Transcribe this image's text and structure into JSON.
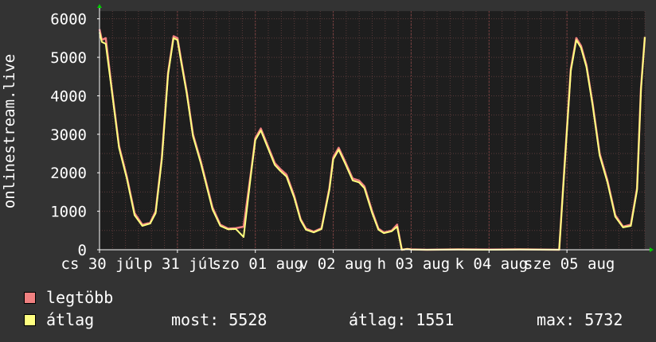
{
  "colors": {
    "background": "#333333",
    "plot_background": "#1e1e1e",
    "grid": "#5a3a3a",
    "axis": "#ffffff",
    "text": "#ffffff",
    "series_max": "#f08080",
    "series_avg": "#ffff80",
    "arrow": "#00cc00"
  },
  "ylabel": "onlinestream.live",
  "legend": {
    "max_label": "legtöbb",
    "avg_label": "átlag",
    "current_label": "most: 5528",
    "average_label": "átlag: 1551",
    "maximum_label": "max: 5732"
  },
  "chart_data": {
    "type": "line",
    "title": "",
    "xlabel": "",
    "ylabel": "onlinestream.live",
    "ylim": [
      0,
      6200
    ],
    "yticks": [
      0,
      1000,
      2000,
      3000,
      4000,
      5000,
      6000
    ],
    "xlim": [
      0,
      7.0
    ],
    "grid": true,
    "xticks": [
      {
        "pos": 0.0,
        "label": "cs 30 júl"
      },
      {
        "pos": 1.0,
        "label": "p 31 júl"
      },
      {
        "pos": 2.0,
        "label": "szo 01 aug"
      },
      {
        "pos": 3.0,
        "label": "v 02 aug"
      },
      {
        "pos": 4.0,
        "label": "h 03 aug"
      },
      {
        "pos": 5.0,
        "label": "k 04 aug"
      },
      {
        "pos": 6.0,
        "label": "sze 05 aug"
      }
    ],
    "series": [
      {
        "name": "legtöbb",
        "color": "#f08080",
        "x": [
          0.0,
          0.03,
          0.08,
          0.15,
          0.25,
          0.35,
          0.45,
          0.55,
          0.65,
          0.72,
          0.8,
          0.88,
          0.95,
          1.0,
          1.05,
          1.12,
          1.2,
          1.3,
          1.45,
          1.55,
          1.65,
          1.75,
          1.85,
          1.95,
          2.0,
          2.07,
          2.15,
          2.25,
          2.32,
          2.4,
          2.5,
          2.58,
          2.65,
          2.75,
          2.85,
          2.95,
          3.0,
          3.07,
          3.15,
          3.25,
          3.33,
          3.4,
          3.5,
          3.58,
          3.65,
          3.75,
          3.82,
          3.88,
          3.95,
          4.0,
          4.2,
          4.6,
          5.0,
          5.4,
          5.9,
          5.96,
          6.05,
          6.12,
          6.18,
          6.25,
          6.33,
          6.42,
          6.52,
          6.62,
          6.72,
          6.82,
          6.9,
          6.95,
          7.0
        ],
        "values": [
          5730,
          5450,
          5500,
          4300,
          2700,
          1900,
          950,
          650,
          700,
          1000,
          2400,
          4600,
          5550,
          5500,
          4900,
          4100,
          3000,
          2300,
          1100,
          650,
          550,
          560,
          600,
          2100,
          2900,
          3150,
          2750,
          2250,
          2100,
          1950,
          1400,
          800,
          550,
          470,
          560,
          1600,
          2400,
          2650,
          2300,
          1850,
          1800,
          1650,
          1000,
          550,
          450,
          500,
          650,
          0,
          20,
          10,
          0,
          10,
          5,
          10,
          0,
          1900,
          4700,
          5500,
          5300,
          4800,
          3800,
          2500,
          1800,
          900,
          600,
          650,
          1600,
          4200,
          5530
        ]
      },
      {
        "name": "átlag",
        "color": "#ffff80",
        "x": [
          0.0,
          0.03,
          0.08,
          0.15,
          0.25,
          0.35,
          0.45,
          0.55,
          0.65,
          0.72,
          0.8,
          0.88,
          0.95,
          1.0,
          1.05,
          1.12,
          1.2,
          1.3,
          1.45,
          1.55,
          1.65,
          1.75,
          1.85,
          1.95,
          2.0,
          2.07,
          2.15,
          2.25,
          2.32,
          2.4,
          2.5,
          2.58,
          2.65,
          2.75,
          2.85,
          2.95,
          3.0,
          3.07,
          3.15,
          3.25,
          3.33,
          3.4,
          3.5,
          3.58,
          3.65,
          3.75,
          3.82,
          3.88,
          3.95,
          4.0,
          4.2,
          4.6,
          5.0,
          5.4,
          5.9,
          5.96,
          6.05,
          6.12,
          6.18,
          6.25,
          6.33,
          6.42,
          6.52,
          6.62,
          6.72,
          6.82,
          6.9,
          6.95,
          7.0
        ],
        "values": [
          5650,
          5400,
          5350,
          4250,
          2650,
          1850,
          900,
          620,
          680,
          950,
          2350,
          4550,
          5500,
          5450,
          4850,
          4050,
          2950,
          2250,
          1050,
          620,
          530,
          540,
          330,
          2050,
          2850,
          3100,
          2700,
          2200,
          2050,
          1900,
          1350,
          770,
          520,
          450,
          540,
          1550,
          2350,
          2600,
          2250,
          1800,
          1750,
          1600,
          950,
          520,
          430,
          480,
          600,
          0,
          15,
          5,
          0,
          5,
          0,
          5,
          0,
          1850,
          4650,
          5450,
          5250,
          4750,
          3750,
          2450,
          1750,
          860,
          580,
          620,
          1550,
          4150,
          5528
        ]
      }
    ]
  }
}
